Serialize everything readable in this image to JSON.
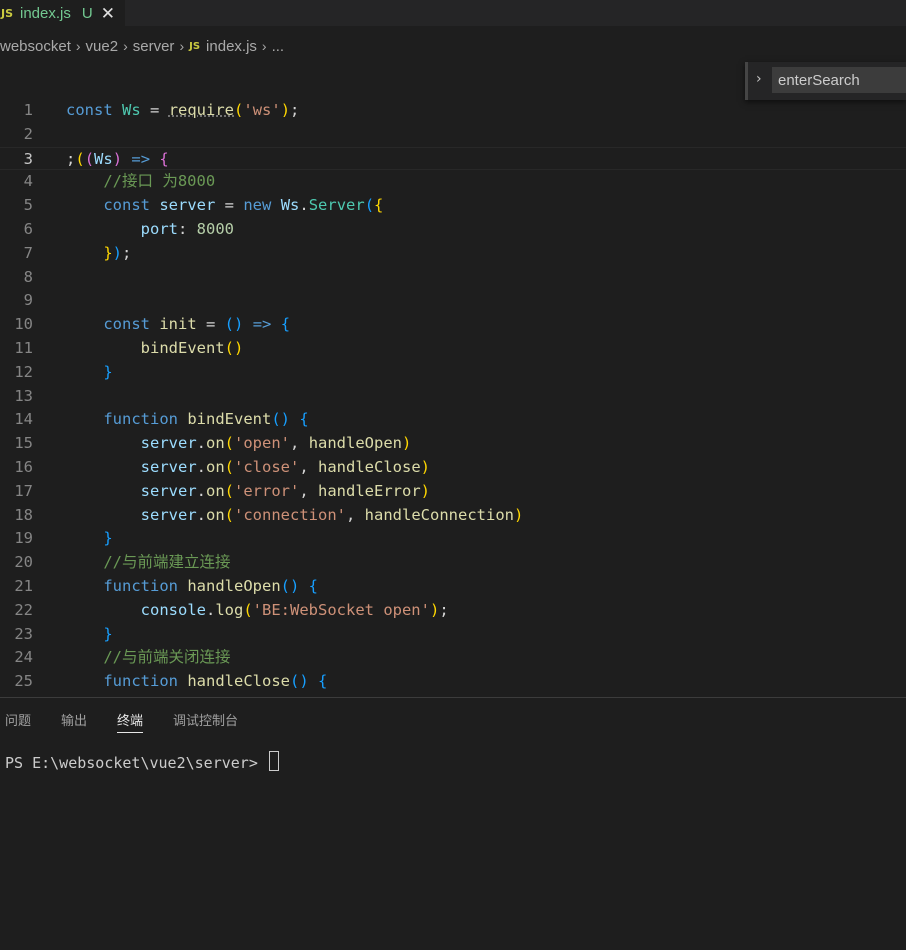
{
  "tab": {
    "icon": "JS",
    "filename": "index.js",
    "status": "U",
    "close_icon": "close-icon"
  },
  "breadcrumb": {
    "items": [
      "websocket",
      "vue2",
      "server"
    ],
    "file_icon": "JS",
    "file": "index.js",
    "ellipsis": "..."
  },
  "find": {
    "toggle_icon": "chevron-right-icon",
    "value": "enterSearch"
  },
  "editor": {
    "line_numbers": [
      "1",
      "2",
      "3",
      "4",
      "5",
      "6",
      "7",
      "8",
      "9",
      "10",
      "11",
      "12",
      "13",
      "14",
      "15",
      "16",
      "17",
      "18",
      "19",
      "20",
      "21",
      "22",
      "23",
      "24",
      "25"
    ],
    "active_line": "3",
    "comments": {
      "port": "//接口 为8000",
      "open": "//与前端建立连接",
      "close": "//与前端关闭连接"
    },
    "strings": {
      "ws": "'ws'",
      "open": "'open'",
      "close": "'close'",
      "error": "'error'",
      "connection": "'connection'",
      "log": "'BE:WebSocket open'"
    },
    "numbers": {
      "port": "8000"
    }
  },
  "panel": {
    "tabs": [
      "问题",
      "输出",
      "终端",
      "调试控制台"
    ],
    "active_tab": "终端",
    "terminal_prompt": "PS E:\\websocket\\vue2\\server> "
  }
}
